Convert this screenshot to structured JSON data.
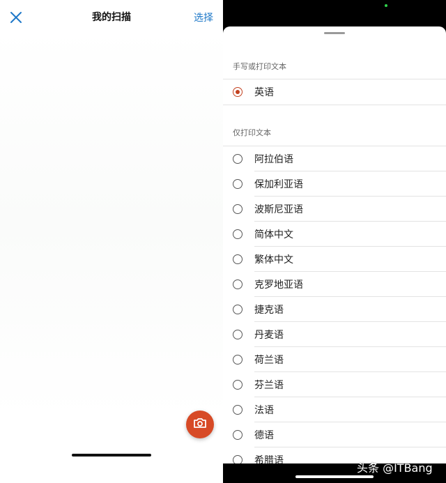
{
  "left": {
    "title": "我的扫描",
    "select_label": "选择",
    "close_icon": "close-icon",
    "camera_icon": "camera-icon",
    "accent_color": "#1e78c8",
    "camera_color": "#d74a26"
  },
  "right": {
    "section_handwritten": "手写或打印文本",
    "handwritten_items": [
      {
        "label": "英语",
        "selected": true
      }
    ],
    "section_printed": "仅打印文本",
    "printed_items": [
      {
        "label": "阿拉伯语"
      },
      {
        "label": "保加利亚语"
      },
      {
        "label": "波斯尼亚语"
      },
      {
        "label": "简体中文"
      },
      {
        "label": "繁体中文"
      },
      {
        "label": "克罗地亚语"
      },
      {
        "label": "捷克语"
      },
      {
        "label": "丹麦语"
      },
      {
        "label": "荷兰语"
      },
      {
        "label": "芬兰语"
      },
      {
        "label": "法语"
      },
      {
        "label": "德语"
      },
      {
        "label": "希腊语"
      }
    ],
    "selected_color": "#c2401f"
  },
  "watermark": "头条 @ITBang"
}
